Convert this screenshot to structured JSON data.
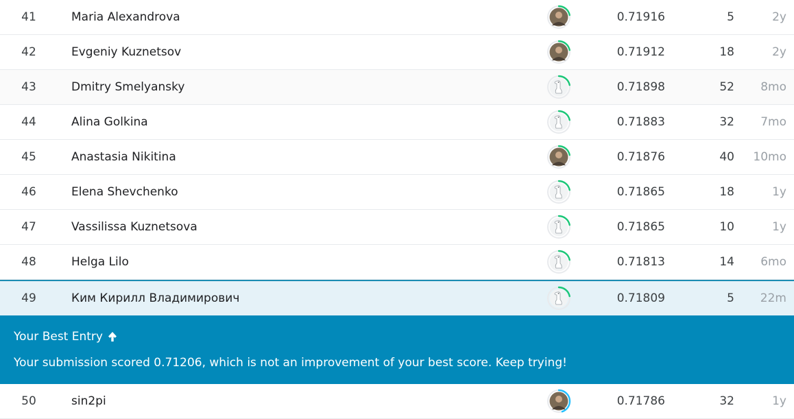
{
  "leaderboard": {
    "rows_before": [
      {
        "rank": "41",
        "name": "Maria Alexandrova",
        "avatar": "photo-avatar-icon",
        "score": "0.71916",
        "entries": "5",
        "last": "2y"
      },
      {
        "rank": "42",
        "name": "Evgeniy Kuznetsov",
        "avatar": "photo-avatar-icon",
        "score": "0.71912",
        "entries": "18",
        "last": "2y"
      },
      {
        "rank": "43",
        "name": "Dmitry Smelyansky",
        "avatar": "default-goose-avatar-icon",
        "score": "0.71898",
        "entries": "52",
        "last": "8mo"
      },
      {
        "rank": "44",
        "name": "Alina Golkina",
        "avatar": "default-goose-avatar-icon",
        "score": "0.71883",
        "entries": "32",
        "last": "7mo"
      },
      {
        "rank": "45",
        "name": "Anastasia Nikitina",
        "avatar": "photo-avatar-icon",
        "score": "0.71876",
        "entries": "40",
        "last": "10mo"
      },
      {
        "rank": "46",
        "name": "Elena Shevchenko",
        "avatar": "default-goose-avatar-icon",
        "score": "0.71865",
        "entries": "18",
        "last": "1y"
      },
      {
        "rank": "47",
        "name": "Vassilissa Kuznetsova",
        "avatar": "default-goose-avatar-icon",
        "score": "0.71865",
        "entries": "10",
        "last": "1y"
      },
      {
        "rank": "48",
        "name": "Helga Lilo",
        "avatar": "default-goose-avatar-icon",
        "score": "0.71813",
        "entries": "14",
        "last": "6mo"
      }
    ],
    "my_row": {
      "rank": "49",
      "name": "Ким Кирилл Владимирович",
      "avatar": "default-goose-avatar-icon",
      "score": "0.71809",
      "entries": "5",
      "last": "22m"
    },
    "banner": {
      "title": "Your Best Entry",
      "icon": "arrow-up-icon",
      "message": "Your submission scored 0.71206, which is not an improvement of your best score. Keep trying!"
    },
    "rows_after": [
      {
        "rank": "50",
        "name": "sin2pi",
        "avatar": "photo-avatar-icon",
        "score": "0.71786",
        "entries": "32",
        "last": "1y"
      }
    ]
  },
  "colors": {
    "banner_bg": "#0289ba",
    "highlight_row_bg": "#e5f2f8",
    "tier_ring_green": "#20beff",
    "progress_ring": "#1ac677"
  }
}
